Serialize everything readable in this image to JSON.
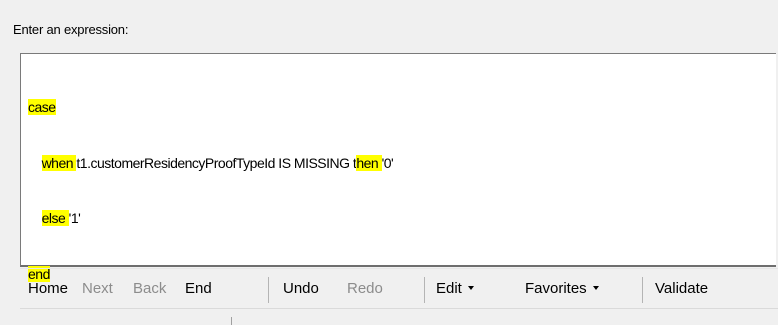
{
  "prompt": {
    "label": "Enter an expression:"
  },
  "expression": {
    "line1": {
      "keyword": "case"
    },
    "line2": {
      "indent": "    ",
      "keyword_when": "when",
      "space": " ",
      "text_mid": "t1.customerResidencyProofTypeId IS MISSING t",
      "keyword_then_hl": "hen",
      "space2": " ",
      "value": "'0'"
    },
    "line3": {
      "indent": "    ",
      "keyword_else": "else",
      "space": " ",
      "value": "'1'"
    },
    "line4": {
      "keyword": "end"
    }
  },
  "highlight_color": "#ffff00",
  "toolbar": {
    "home": "Home",
    "next": "Next",
    "back": "Back",
    "end": "End",
    "undo": "Undo",
    "redo": "Redo",
    "edit": "Edit",
    "favorites": "Favorites",
    "validate": "Validate"
  }
}
